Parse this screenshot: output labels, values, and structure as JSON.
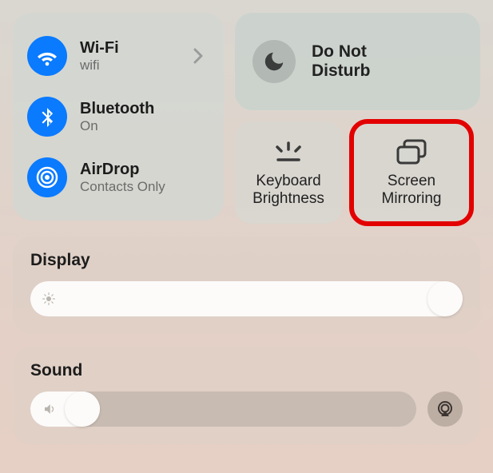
{
  "connectivity": {
    "wifi": {
      "title": "Wi-Fi",
      "sub": "wifi"
    },
    "bt": {
      "title": "Bluetooth",
      "sub": "On"
    },
    "airdrop": {
      "title": "AirDrop",
      "sub": "Contacts Only"
    }
  },
  "dnd": {
    "line1": "Do Not",
    "line2": "Disturb"
  },
  "mini": {
    "kb": {
      "line1": "Keyboard",
      "line2": "Brightness"
    },
    "sm": {
      "line1": "Screen",
      "line2": "Mirroring"
    }
  },
  "display": {
    "title": "Display",
    "value_pct": 100
  },
  "sound": {
    "title": "Sound",
    "value_pct": 18
  },
  "colors": {
    "accent": "#0a7aff",
    "highlight": "#e30000"
  }
}
